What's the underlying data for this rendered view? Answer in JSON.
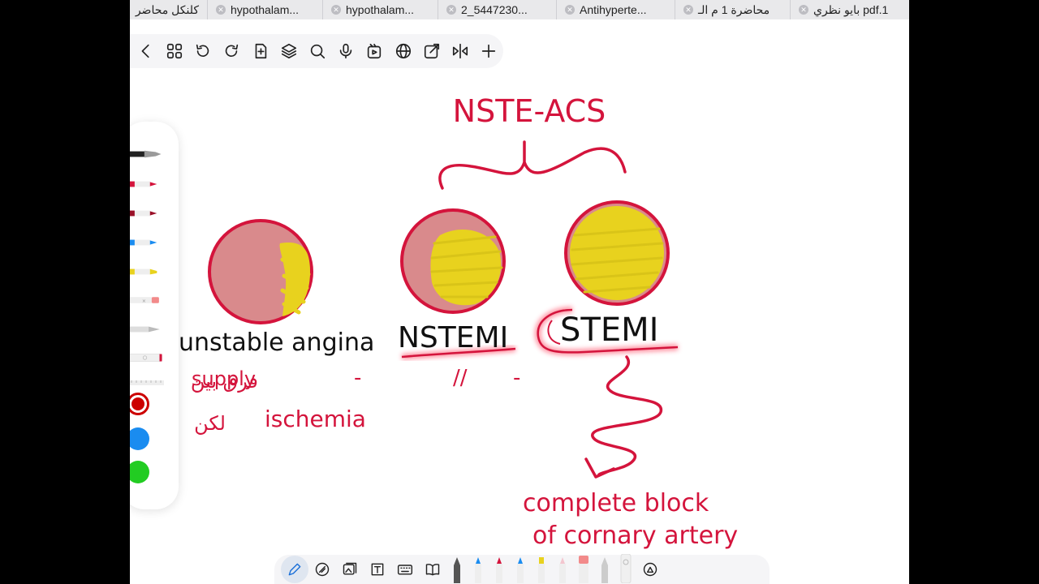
{
  "tabs": [
    {
      "label": "كلنكل محاضر"
    },
    {
      "label": "hypothalam..."
    },
    {
      "label": "hypothalam..."
    },
    {
      "label": "2_5447230..."
    },
    {
      "label": "Antihyperte..."
    },
    {
      "label": "محاضرة 1 م الـ"
    },
    {
      "label": "بايو نظري pdf.1"
    }
  ],
  "toolbar_icons": [
    "back-icon",
    "grid-icon",
    "undo-icon",
    "redo-icon",
    "add-page-icon",
    "layers-icon",
    "search-icon",
    "microphone-icon",
    "media-icon",
    "globe-icon",
    "export-icon",
    "split-view-icon",
    "plus-icon"
  ],
  "colors": {
    "ink_red": "#d4143c",
    "ink_black": "#111111",
    "circle_fill": "#d98a8c",
    "yellow": "#e8d21e",
    "swatch_red": "#cc0000",
    "swatch_blue": "#1a8cf0",
    "swatch_green": "#22cc22",
    "toolbar_bg": "#f5f5f7"
  },
  "notes": {
    "title": "NSTE-ACS",
    "ua_label": "unstable angina",
    "ua_note1_ar": "فرق بين",
    "ua_note1_en": "supply",
    "ua_note1_dash": "-",
    "ua_note2_ar": "لكن",
    "ua_note2_en": "ischemia",
    "nstemi_label": "NSTEMI",
    "nstemi_mark1": "//",
    "nstemi_mark2": "-",
    "stemi_label": "STEMI",
    "stemi_note_line1": "complete block",
    "stemi_note_line2": "of cornary artery"
  },
  "pen_tray": {
    "colors": [
      "red",
      "blue",
      "green"
    ],
    "selected": "red"
  },
  "bottom_tools": [
    "pen-tool-icon",
    "highlighter-icon",
    "image-icon",
    "text-box-icon",
    "keyboard-icon",
    "book-icon"
  ]
}
